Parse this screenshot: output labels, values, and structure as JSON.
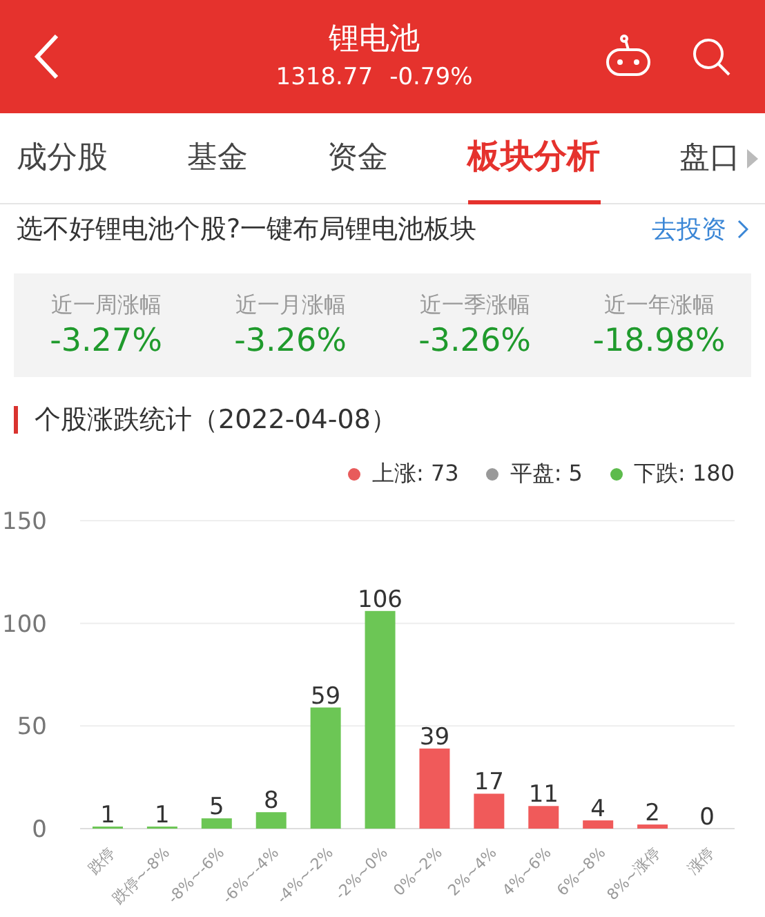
{
  "header": {
    "title": "锂电池",
    "price": "1318.77",
    "change": "-0.79%"
  },
  "tabs": [
    {
      "label": "成分股",
      "selected": false
    },
    {
      "label": "基金",
      "selected": false
    },
    {
      "label": "资金",
      "selected": false
    },
    {
      "label": "板块分析",
      "selected": true
    },
    {
      "label": "盘口",
      "selected": false
    }
  ],
  "banner": {
    "text": "选不好锂电池个股?一键布局锂电池板块",
    "link": "去投资"
  },
  "stats": [
    {
      "label": "近一周涨幅",
      "value": "-3.27%"
    },
    {
      "label": "近一月涨幅",
      "value": "-3.26%"
    },
    {
      "label": "近一季涨幅",
      "value": "-3.26%"
    },
    {
      "label": "近一年涨幅",
      "value": "-18.98%"
    }
  ],
  "section": {
    "title": "个股涨跌统计（2022-04-08）",
    "legend": [
      {
        "label": "上涨: 73",
        "color": "#e85b5b"
      },
      {
        "label": "平盘: 5",
        "color": "#999999"
      },
      {
        "label": "下跌: 180",
        "color": "#5dbb4c"
      }
    ],
    "chart_data": {
      "type": "bar",
      "categories": [
        "跌停",
        "跌停~-8%",
        "-8%~-6%",
        "-6%~-4%",
        "-4%~-2%",
        "-2%~0%",
        "0%~2%",
        "2%~4%",
        "4%~6%",
        "6%~8%",
        "8%~涨停",
        "涨停"
      ],
      "series": [
        {
          "color": "#6cc655",
          "values": [
            1,
            1,
            5,
            8,
            59,
            106,
            null,
            null,
            null,
            null,
            null,
            null
          ]
        },
        {
          "color": "#f05a5a",
          "values": [
            null,
            null,
            null,
            null,
            null,
            null,
            39,
            17,
            11,
            4,
            2,
            0
          ]
        }
      ],
      "ylim": [
        0,
        150
      ],
      "yticks": [
        0,
        50,
        100,
        150
      ],
      "data_labels": true
    }
  }
}
